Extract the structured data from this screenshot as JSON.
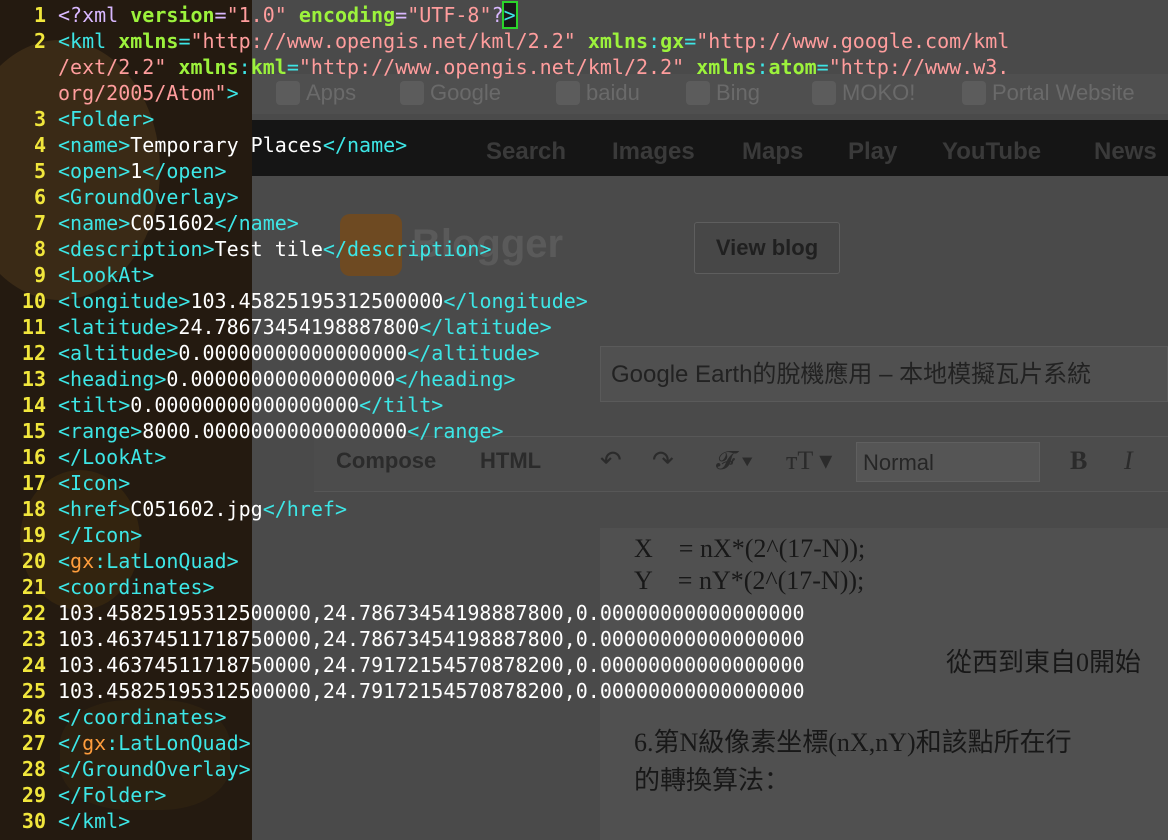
{
  "background": {
    "bookmarks": [
      "Apps",
      "Google",
      "baidu",
      "Bing",
      "MOKO!",
      "Portal Website"
    ],
    "google_bar": [
      "Search",
      "Images",
      "Maps",
      "Play",
      "YouTube",
      "News"
    ],
    "view_blog": "View blog",
    "post_title": "Google Earth的脫機應用 – 本地模擬瓦片系統",
    "tabs": [
      "Compose",
      "HTML"
    ],
    "format_select": "Normal",
    "doc_lines": [
      "X　= nX*(2^(17-N));",
      "Y　= nY*(2^(17-N));",
      "從西到東自0開始",
      "6.第N級像素坐標(nX,nY)和該點所在行",
      "的轉換算法："
    ]
  },
  "terminal": {
    "line_numbers": [
      "1",
      "2",
      "",
      "",
      "3",
      "4",
      "5",
      "6",
      "7",
      "8",
      "9",
      "10",
      "11",
      "12",
      "13",
      "14",
      "15",
      "16",
      "17",
      "18",
      "19",
      "20",
      "21",
      "22",
      "23",
      "24",
      "25",
      "26",
      "27",
      "28",
      "29",
      "30"
    ],
    "lines": {
      "l1": {
        "p1": "<?xml ",
        "p2": "version",
        "p3": "=",
        "p4": "\"1.0\" ",
        "p5": "encoding",
        "p6": "=",
        "p7": "\"UTF-8\"",
        "p8": "?",
        "p9": ">"
      },
      "l2a": {
        "p1": "<kml ",
        "p2": "xmlns",
        "p3": "=",
        "p4": "\"http://www.opengis.net/kml/2.2\" ",
        "p5": "xmlns",
        "p6": ":",
        "p7": "gx",
        "p8": "=",
        "p9": "\"http://www.google.com/kml"
      },
      "l2b": {
        "p1": "/ext/2.2\" ",
        "p2": "xmlns",
        "p3": ":",
        "p4": "kml",
        "p5": "=",
        "p6": "\"http://www.opengis.net/kml/2.2\" ",
        "p7": "xmlns",
        "p8": ":",
        "p9": "atom",
        "p10": "=",
        "p11": "\"http://www.w3."
      },
      "l2c": {
        "p1": "org/2005/Atom\"",
        "p2": ">"
      },
      "l3": {
        "p1": "<Folder>"
      },
      "l4": {
        "p1": "<name>",
        "p2": "Temporary Places",
        "p3": "</name>"
      },
      "l5": {
        "p1": "<open>",
        "p2": "1",
        "p3": "</open>"
      },
      "l6": {
        "p1": "<GroundOverlay>"
      },
      "l7": {
        "p1": "<name>",
        "p2": "C051602",
        "p3": "</name>"
      },
      "l8": {
        "p1": "<description>",
        "p2": "Test tile",
        "p3": "</description>"
      },
      "l9": {
        "p1": "<LookAt>"
      },
      "l10": {
        "p1": "<longitude>",
        "p2": "103.45825195312500000",
        "p3": "</longitude>"
      },
      "l11": {
        "p1": "<latitude>",
        "p2": "24.78673454198887800",
        "p3": "</latitude>"
      },
      "l12": {
        "p1": "<altitude>",
        "p2": "0.00000000000000000",
        "p3": "</altitude>"
      },
      "l13": {
        "p1": "<heading>",
        "p2": "0.00000000000000000",
        "p3": "</heading>"
      },
      "l14": {
        "p1": "<tilt>",
        "p2": "0.00000000000000000",
        "p3": "</tilt>"
      },
      "l15": {
        "p1": "<range>",
        "p2": "8000.00000000000000000",
        "p3": "</range>"
      },
      "l16": {
        "p1": "</LookAt>"
      },
      "l17": {
        "p1": "<Icon>"
      },
      "l18": {
        "p1": "<href>",
        "p2": "C051602.jpg",
        "p3": "</href>"
      },
      "l19": {
        "p1": "</Icon>"
      },
      "l20": {
        "p1": "<",
        "p2": "gx",
        "p3": ":",
        "p4": "LatLonQuad>"
      },
      "l21": {
        "p1": "<coordinates>"
      },
      "l22": {
        "p1": "103.45825195312500000,24.78673454198887800,0.00000000000000000"
      },
      "l23": {
        "p1": "103.46374511718750000,24.78673454198887800,0.00000000000000000"
      },
      "l24": {
        "p1": "103.46374511718750000,24.79172154570878200,0.00000000000000000"
      },
      "l25": {
        "p1": "103.45825195312500000,24.79172154570878200,0.00000000000000000"
      },
      "l26": {
        "p1": "</coordinates>"
      },
      "l27": {
        "p1": "</",
        "p2": "gx",
        "p3": ":",
        "p4": "LatLonQuad>"
      },
      "l28": {
        "p1": "</GroundOverlay>"
      },
      "l29": {
        "p1": "</Folder>"
      },
      "l30": {
        "p1": "</kml>"
      }
    }
  }
}
